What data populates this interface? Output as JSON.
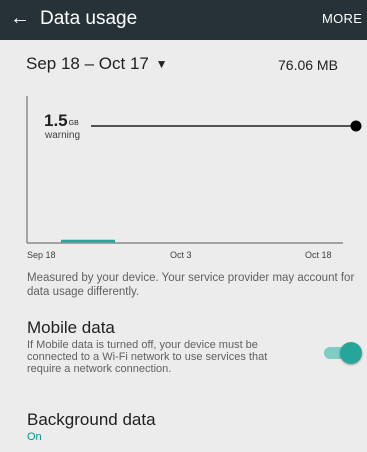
{
  "toolbar": {
    "back_icon": "arrow-back-icon",
    "title": "Data usage",
    "more_label": "MORE"
  },
  "cycle": {
    "range_label": "Sep 18 – Oct 17",
    "dropdown_icon": "triangle-down-icon",
    "total_usage": "76.06 MB"
  },
  "chart_data": {
    "type": "line",
    "x_tick_labels": [
      "Sep 18",
      "Oct 3",
      "Oct 18"
    ],
    "warning": {
      "value": 1.5,
      "unit": "GB",
      "label": "warning"
    },
    "usage_series": {
      "x_start": "Sep 19",
      "x_end": "Sep 22",
      "color": "#26a69a"
    },
    "grid": false
  },
  "warning_text": {
    "value": "1.5",
    "unit": "GB"
  },
  "note": "Measured by your device. Your service provider may account for data usage differently.",
  "mobile_data": {
    "title": "Mobile data",
    "description": "If Mobile data is turned off, your device must be connected to a Wi-Fi network to use services that require a network connection.",
    "enabled": true
  },
  "background_data": {
    "title": "Background data",
    "value": "On"
  },
  "colors": {
    "toolbar": "#263238",
    "background": "#ececec",
    "accent": "#009688",
    "toggle_thumb": "#26a69a",
    "toggle_track": "#80cbc4"
  }
}
